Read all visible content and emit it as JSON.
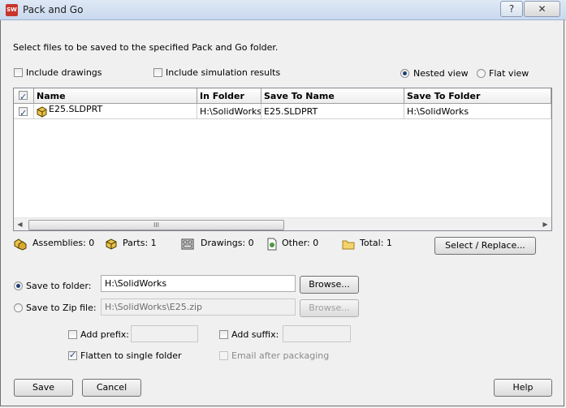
{
  "window": {
    "title": "Pack and Go",
    "help_glyph": "?",
    "close_glyph": "✕"
  },
  "instructions": "Select files to be saved to the specified Pack and Go folder.",
  "options": {
    "include_drawings": {
      "label": "Include drawings",
      "checked": false
    },
    "include_simulation": {
      "label": "Include simulation results",
      "checked": false
    },
    "nested_view": {
      "label": "Nested view",
      "selected": true
    },
    "flat_view": {
      "label": "Flat view",
      "selected": false
    }
  },
  "table": {
    "columns": [
      "Name",
      "In Folder",
      "Save To Name",
      "Save To Folder"
    ],
    "rows": [
      {
        "checked": true,
        "name": "E25.SLDPRT",
        "in_folder": "H:\\SolidWorks",
        "save_to_name": "E25.SLDPRT",
        "save_to_folder": "H:\\SolidWorks"
      }
    ],
    "scroll_grip": "III"
  },
  "summary": {
    "assemblies": "Assemblies: 0",
    "parts": "Parts: 1",
    "drawings": "Drawings: 0",
    "other": "Other: 0",
    "total": "Total: 1",
    "select_replace": "Select / Replace..."
  },
  "save": {
    "to_folder_label": "Save to folder:",
    "to_folder_value": "H:\\SolidWorks",
    "to_zip_label": "Save to Zip file:",
    "to_zip_value": "H:\\SolidWorks\\E25.zip",
    "browse": "Browse...",
    "mode": "folder"
  },
  "extras": {
    "add_prefix": "Add prefix:",
    "add_suffix": "Add suffix:",
    "flatten": "Flatten to single folder",
    "flatten_checked": true,
    "email": "Email after packaging"
  },
  "buttons": {
    "save": "Save",
    "cancel": "Cancel",
    "help": "Help"
  },
  "icons": {
    "app": "solidworks-app-icon",
    "assembly": "assembly-icon",
    "part": "part-icon",
    "drawing": "drawing-icon",
    "other": "other-file-icon",
    "total": "folder-icon"
  }
}
